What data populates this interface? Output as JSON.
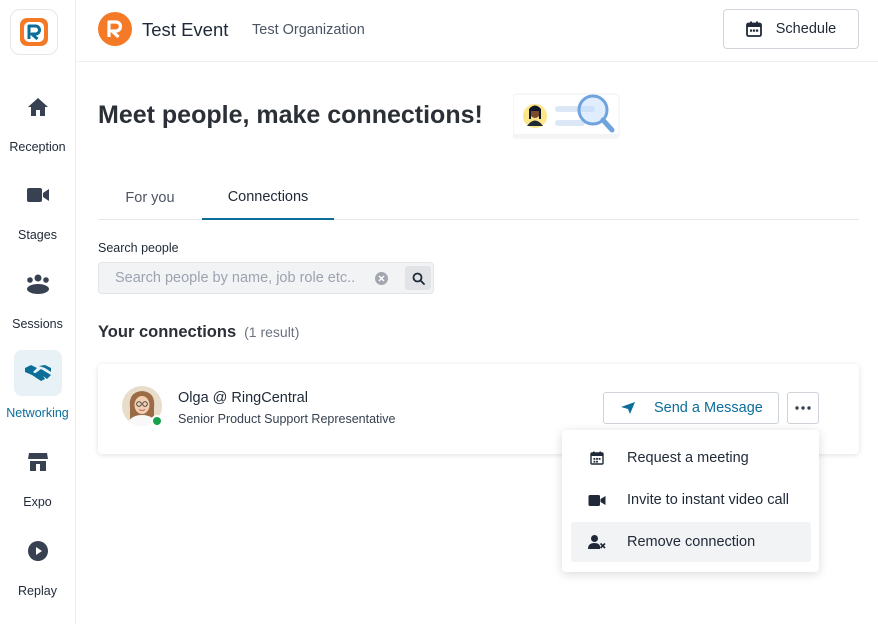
{
  "sidebar": {
    "items": [
      {
        "label": "Reception",
        "icon": "home-icon"
      },
      {
        "label": "Stages",
        "icon": "video-camera-icon"
      },
      {
        "label": "Sessions",
        "icon": "people-group-icon"
      },
      {
        "label": "Networking",
        "icon": "handshake-icon",
        "active": true
      },
      {
        "label": "Expo",
        "icon": "storefront-icon"
      },
      {
        "label": "Replay",
        "icon": "play-circle-icon"
      }
    ]
  },
  "header": {
    "event_title": "Test Event",
    "org_name": "Test Organization",
    "schedule_label": "Schedule"
  },
  "main": {
    "title": "Meet people, make connections!",
    "tabs": [
      {
        "label": "For you",
        "active": false
      },
      {
        "label": "Connections",
        "active": true
      }
    ],
    "search": {
      "label": "Search people",
      "placeholder": "Search people by name, job role etc.."
    },
    "connections": {
      "title": "Your connections",
      "count": "(1 result)",
      "items": [
        {
          "name": "Olga @ RingCentral",
          "role": "Senior Product Support Representative",
          "status": "online",
          "message_label": "Send a Message"
        }
      ]
    },
    "menu": {
      "items": [
        {
          "label": "Request a meeting",
          "icon": "calendar-icon"
        },
        {
          "label": "Invite to instant video call",
          "icon": "video-camera-icon"
        },
        {
          "label": "Remove connection",
          "icon": "remove-user-icon"
        }
      ]
    }
  },
  "colors": {
    "accent": "#0b6e99",
    "brand_orange": "#f47a27",
    "online": "#17a34a"
  }
}
